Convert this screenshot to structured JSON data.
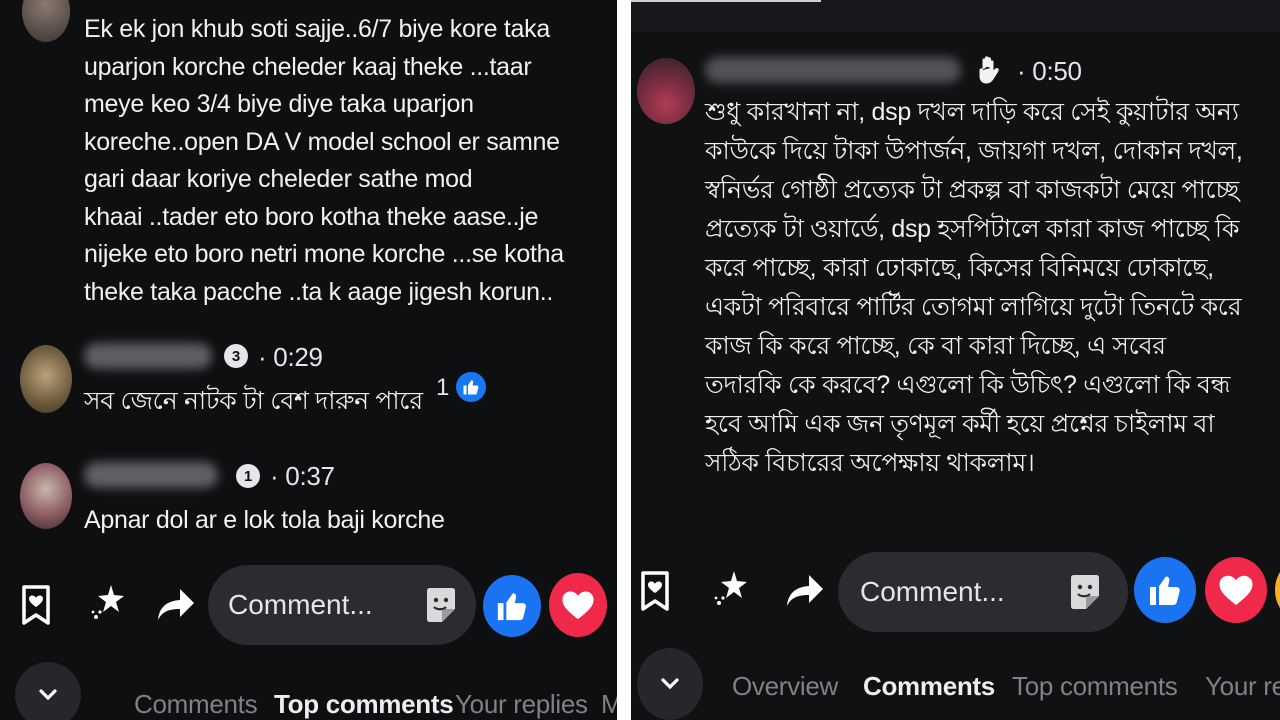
{
  "left": {
    "comment1": {
      "text": "Ek ek jon khub soti sajje..6/7 biye kore taka\nuparjon korche cheleder kaaj theke ...taar\nmeye keo 3/4  biye diye taka uparjon\nkoreche..open DA V model school er samne\ngari daar koriye cheleder sathe mod\nkhaai ..tader eto boro kotha theke aase..je\nnijeke eto boro netri mone korche ...se kotha\ntheke taka pacche ..ta k aage jigesh korun.."
    },
    "comment2": {
      "badge": "3",
      "time": "· 0:29",
      "text": "সব জেনে নাটক টা বেশ দারুন পারে",
      "like_count": "1"
    },
    "comment3": {
      "badge": "1",
      "time": "· 0:37",
      "text": "Apnar dol ar e lok tola baji korche"
    },
    "comment_placeholder": "Comment...",
    "tabs": [
      "Comments",
      "Top comments",
      "Your replies",
      "M"
    ],
    "active_tab": "Top comments"
  },
  "right": {
    "comment": {
      "time": "· 0:50",
      "text": "শুধু কারখানা না, dsp দখল দাড়ি করে সেই কুয়াটার অন্য কাউকে দিয়ে টাকা উপার্জন, জায়গা দখল, দোকান দখল, স্বনির্ভর গোষ্ঠী প্রত্যেক টা প্রকল্প বা কাজকটা মেয়ে পাচ্ছে প্রত্যেক টা ওয়ার্ডে, dsp হসপিটালে কারা কাজ পাচ্ছে কি করে পাচ্ছে, কারা ঢোকাছে, কিসের বিনিময়ে ঢোকাছে, একটা পরিবারে পার্টির তোগমা লাগিয়ে দুটো তিনটে করে কাজ কি করে পাচ্ছে, কে বা কারা দিচ্ছে, এ সবের তদারকি কে করবে? এগুলো কি উচিৎ? এগুলো কি বন্ধ হবে আমি এক জন তৃণমূল কর্মী হয়ে প্রশ্নের চাইলাম বা সঠিক বিচারের অপেক্ষায় থাকলাম।"
    },
    "comment_placeholder": "Comment...",
    "tabs": [
      "Overview",
      "Comments",
      "Top comments",
      "Your re"
    ],
    "active_tab": "Comments"
  },
  "colors": {
    "background": "#0e0f11",
    "like_blue": "#1877f2",
    "love_red": "#f33e58",
    "input_bg": "#2b2c2f",
    "muted_text": "#7e8185"
  }
}
